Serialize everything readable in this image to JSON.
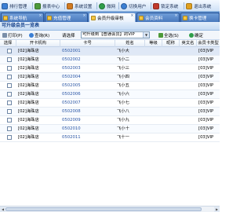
{
  "toolbar": {
    "items": [
      {
        "label": "排行管理",
        "icon": "ranking-icon",
        "color": "#3b7fd4"
      },
      {
        "label": "报表中心",
        "icon": "report-icon",
        "color": "#4d9a3a"
      },
      {
        "label": "系统设置",
        "icon": "settings-icon",
        "color": "#d17a22"
      },
      {
        "label": "微网",
        "icon": "globe-icon",
        "color": "#2f9e4a"
      },
      {
        "label": "切换用户",
        "icon": "switch-user-icon",
        "color": "#3b7fd4"
      },
      {
        "label": "锁定系统",
        "icon": "lock-icon",
        "color": "#c0392b"
      },
      {
        "label": "退出系统",
        "icon": "exit-icon",
        "color": "#e0a020"
      }
    ]
  },
  "tabs": [
    {
      "label": "系统导航",
      "active": false
    },
    {
      "label": "充值管理",
      "active": false
    },
    {
      "label": "会员升级审核",
      "active": true
    },
    {
      "label": "会员资料",
      "active": false
    },
    {
      "label": "换卡管理",
      "active": false
    }
  ],
  "panel_title": "可升级会员一览表",
  "actionbar": {
    "print": "打印(P)",
    "query": "查询(R)",
    "select_label": "请选择",
    "select_value": "可升级到【普通会员】的VIP",
    "select_all": "全选(S)",
    "confirm": "确定"
  },
  "grid": {
    "columns": [
      "选择",
      "开卡机构",
      "卡号",
      "姓名",
      "等级",
      "昵称",
      "英文名",
      "会员卡类型"
    ],
    "rows": [
      {
        "org": "[02]海珠店",
        "card": "0502001",
        "name": "飞小大",
        "type": "[03]VIP"
      },
      {
        "org": "[02]海珠店",
        "card": "0502002",
        "name": "飞小二",
        "type": "[03]VIP"
      },
      {
        "org": "[02]海珠店",
        "card": "0502003",
        "name": "飞小三",
        "type": "[03]VIP"
      },
      {
        "org": "[02]海珠店",
        "card": "0502004",
        "name": "飞小四",
        "type": "[03]VIP"
      },
      {
        "org": "[02]海珠店",
        "card": "0502005",
        "name": "飞小五",
        "type": "[03]VIP"
      },
      {
        "org": "[02]海珠店",
        "card": "0502006",
        "name": "飞小六",
        "type": "[03]VIP"
      },
      {
        "org": "[02]海珠店",
        "card": "0502007",
        "name": "飞小七",
        "type": "[03]VIP"
      },
      {
        "org": "[02]海珠店",
        "card": "0502008",
        "name": "飞小八",
        "type": "[03]VIP"
      },
      {
        "org": "[02]海珠店",
        "card": "0502009",
        "name": "飞小九",
        "type": "[03]VIP"
      },
      {
        "org": "[02]海珠店",
        "card": "0502010",
        "name": "飞小十",
        "type": "[03]VIP"
      },
      {
        "org": "[02]海珠店",
        "card": "0502011",
        "name": "飞十一",
        "type": "[03]VIP"
      }
    ]
  }
}
